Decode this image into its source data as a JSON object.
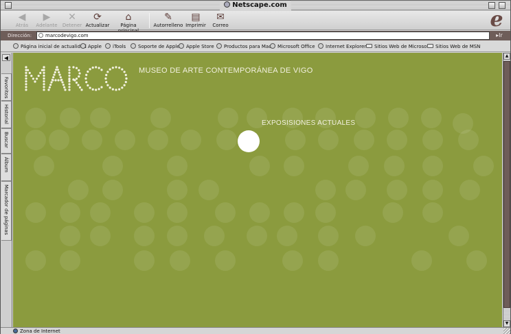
{
  "window": {
    "title": "Netscape.com"
  },
  "toolbar": {
    "buttons": [
      {
        "label": "Atrás",
        "icon": "back-arrow-icon",
        "enabled": false
      },
      {
        "label": "Adelante",
        "icon": "forward-arrow-icon",
        "enabled": false
      },
      {
        "label": "Detener",
        "icon": "stop-icon",
        "enabled": false
      },
      {
        "label": "Actualizar",
        "icon": "refresh-icon",
        "enabled": true
      },
      {
        "label": "Página principal",
        "icon": "home-icon",
        "enabled": true
      },
      {
        "label": "Autorrelleno",
        "icon": "autofill-icon",
        "enabled": true
      },
      {
        "label": "Imprimir",
        "icon": "print-icon",
        "enabled": true
      },
      {
        "label": "Correo",
        "icon": "mail-icon",
        "enabled": true
      }
    ]
  },
  "address": {
    "label": "Dirección:",
    "url": "marcodevigo.com",
    "go_label": "Ir"
  },
  "favorites": [
    {
      "label": "Página inicial de actualidad",
      "type": "link"
    },
    {
      "label": "Apple",
      "type": "link"
    },
    {
      "label": "iTools",
      "type": "link"
    },
    {
      "label": "Soporte de Apple",
      "type": "link"
    },
    {
      "label": "Apple Store",
      "type": "link"
    },
    {
      "label": "Productos para Mac",
      "type": "link"
    },
    {
      "label": "Microsoft Office",
      "type": "link"
    },
    {
      "label": "Internet Explorer",
      "type": "link"
    },
    {
      "label": "Sitios Web de Microsoft",
      "type": "folder"
    },
    {
      "label": "Sitios Web de MSN",
      "type": "folder"
    }
  ],
  "sidebar": {
    "tabs": [
      {
        "label": "Favoritos"
      },
      {
        "label": "Historial"
      },
      {
        "label": "Buscar"
      },
      {
        "label": "Álbum"
      },
      {
        "label": "Marcador de páginas"
      }
    ]
  },
  "page": {
    "logo_text": "MARCO",
    "museum_name": "MUSEO DE ARTE CONTEMPORÁNEA DE VIGO",
    "current_exhibitions": "EXPOSISIONES ACTUALES",
    "background_color": "#8b9b3e"
  },
  "status": {
    "zone": "Zona de Internet"
  }
}
